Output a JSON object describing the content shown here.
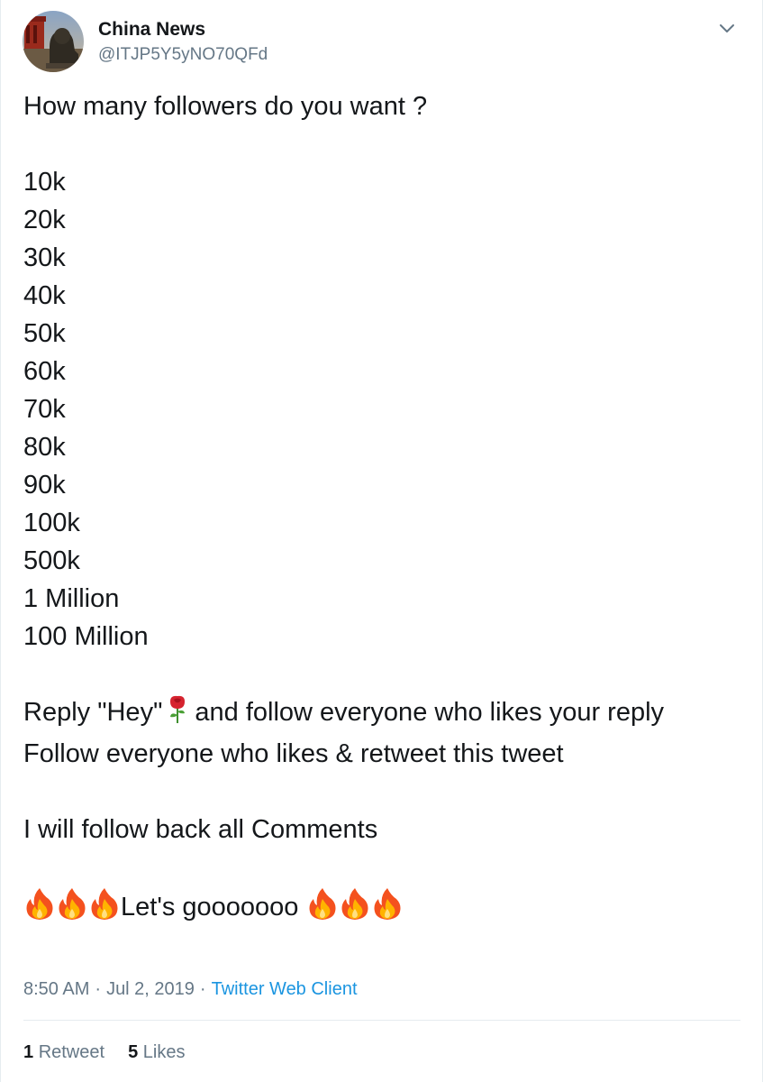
{
  "user": {
    "display_name": "China News",
    "handle": "@ITJP5Y5yNO70QFd",
    "avatar_icon": "gate-lion-statue-photo"
  },
  "tweet": {
    "question": "How many followers do you want ?",
    "options": [
      "10k",
      "20k",
      "30k",
      "40k",
      "50k",
      "60k",
      "70k",
      "80k",
      "90k",
      "100k",
      "500k",
      "1 Million",
      "100 Million"
    ],
    "reply_prefix": "Reply \"Hey\"",
    "reply_suffix": "and follow everyone who likes your reply",
    "follow_line": "Follow everyone who likes & retweet this tweet",
    "followback_line": "I will follow back all Comments",
    "cta": "Let's gooooooo",
    "rose_icon": "rose-emoji",
    "fire_icon": "fire-emoji"
  },
  "meta": {
    "time": "8:50 AM",
    "date": "Jul 2, 2019",
    "separator": "·",
    "source": "Twitter Web Client"
  },
  "stats": {
    "retweets_count": "1",
    "retweets_label": "Retweet",
    "likes_count": "5",
    "likes_label": "Likes"
  },
  "colors": {
    "text": "#14171a",
    "secondary": "#657786",
    "link": "#1b95e0",
    "border": "#e6ecf0"
  }
}
